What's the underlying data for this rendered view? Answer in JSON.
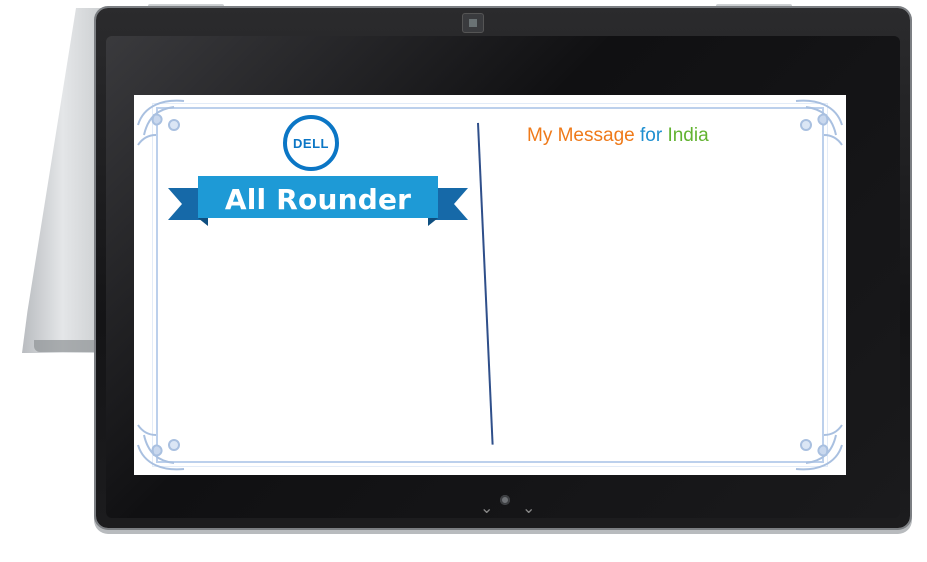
{
  "card": {
    "brand": "DELL",
    "ribbon_text": "All Rounder",
    "message_parts": [
      "My Message ",
      "for ",
      "India"
    ]
  },
  "colors": {
    "brand_blue": "#0b76c5",
    "ribbon_blue": "#1e9ad6",
    "orange": "#ef7a1a",
    "blue": "#1e8fd0",
    "green": "#62b330",
    "divider": "#2f4f8a",
    "frame": "#bcd0ec"
  },
  "icons": [
    "dell-logo",
    "camera-icon",
    "home-button-icon",
    "ornament-corner-icon"
  ]
}
